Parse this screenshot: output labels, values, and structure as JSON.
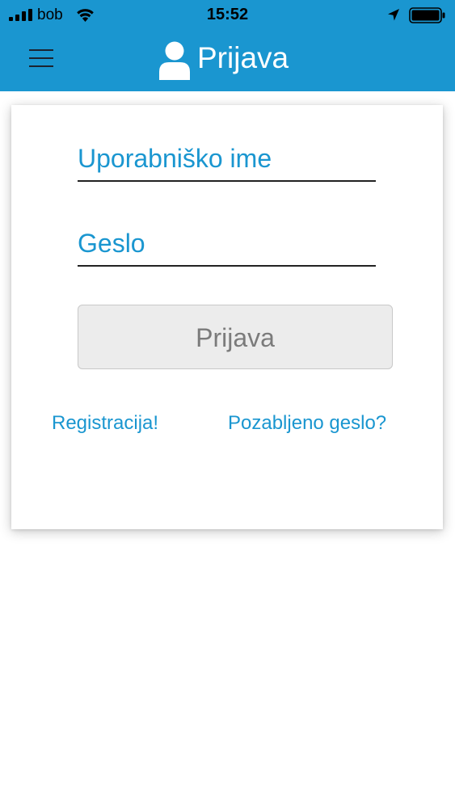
{
  "status_bar": {
    "carrier": "bob",
    "time": "15:52",
    "icons": [
      "signal-bars-icon",
      "wifi-icon",
      "location-arrow-icon",
      "battery-icon"
    ]
  },
  "header": {
    "title": "Prijava",
    "icons": [
      "hamburger-menu-icon",
      "user-icon"
    ],
    "background_color": "#1a96d0"
  },
  "login_form": {
    "username_placeholder": "Uporabniško ime",
    "password_placeholder": "Geslo",
    "submit_label": "Prijava",
    "register_link": "Registracija!",
    "forgot_password_link": "Pozabljeno geslo?"
  },
  "colors": {
    "accent": "#1a96d0",
    "button_bg": "#ececec",
    "button_text": "#7b7b7b"
  }
}
